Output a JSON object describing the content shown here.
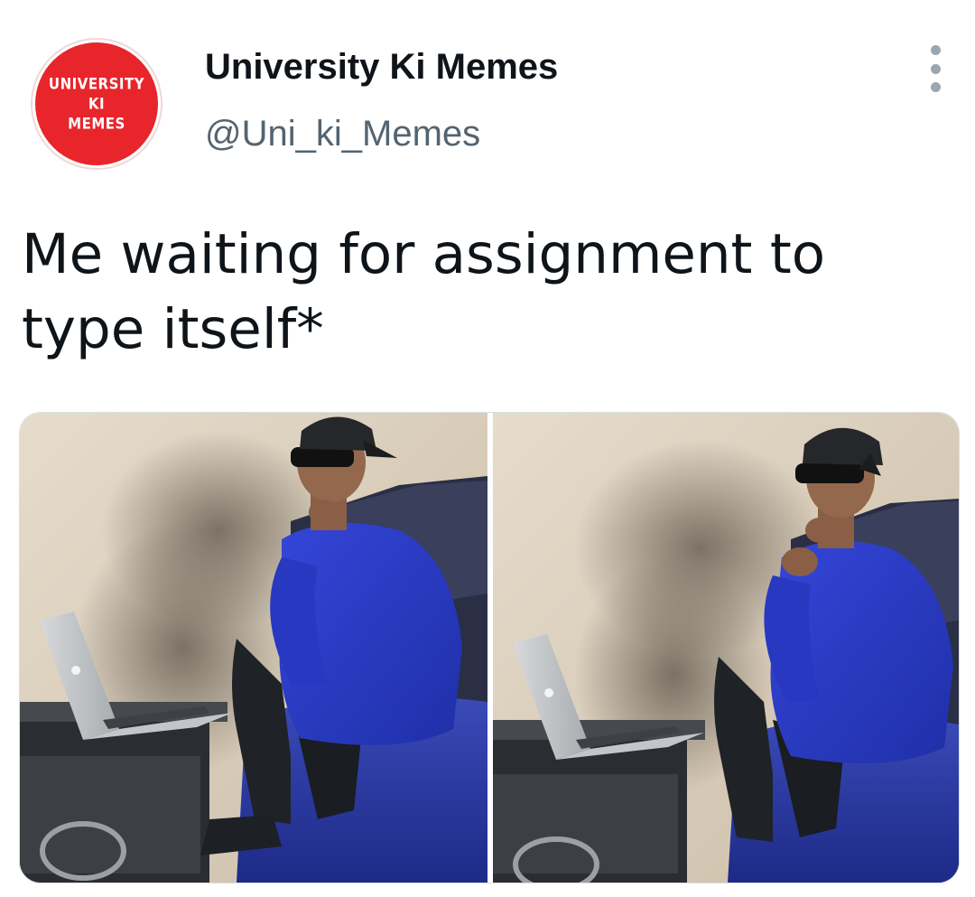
{
  "tweet": {
    "avatar_lines": [
      "UNIVERSITY",
      "KI",
      "MEMES"
    ],
    "display_name": "University Ki Memes",
    "handle": "@Uni_ki_Memes",
    "text": "Me waiting for assignment to type itself*"
  },
  "icons": {
    "more": "more-vertical-icon"
  },
  "colors": {
    "avatar_bg": "#e8252b",
    "handle_gray": "#536471",
    "text_dark": "#0f1419",
    "sweater_blue": "#2b3ccf"
  }
}
